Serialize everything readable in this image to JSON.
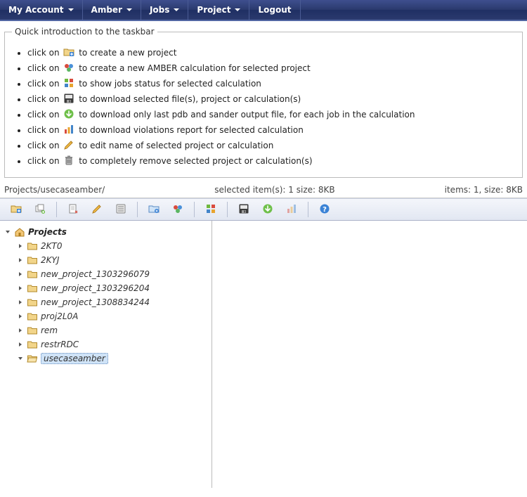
{
  "menubar": {
    "items": [
      {
        "label": "My Account",
        "dropdown": true
      },
      {
        "label": "Amber",
        "dropdown": true
      },
      {
        "label": "Jobs",
        "dropdown": true
      },
      {
        "label": "Project",
        "dropdown": true
      },
      {
        "label": "Logout",
        "dropdown": false
      }
    ]
  },
  "intro": {
    "legend": "Quick introduction to the taskbar",
    "items": [
      {
        "pre": "click on ",
        "icon": "new-project-icon",
        "post": " to create a new project"
      },
      {
        "pre": "click on ",
        "icon": "new-calc-icon",
        "post": " to create a new AMBER calculation for selected project"
      },
      {
        "pre": "click on ",
        "icon": "jobs-status-icon",
        "post": " to show jobs status for selected calculation"
      },
      {
        "pre": "click on ",
        "icon": "save-icon",
        "post": " to download selected file(s), project or calculation(s)"
      },
      {
        "pre": "click on ",
        "icon": "download-last-icon",
        "post": " to download only last pdb and sander output file, for each job in the calculation"
      },
      {
        "pre": "click on ",
        "icon": "violations-icon",
        "post": " to download violations report for selected calculation"
      },
      {
        "pre": "click on ",
        "icon": "edit-icon",
        "post": " to edit name of selected project or calculation"
      },
      {
        "pre": "click on ",
        "icon": "delete-icon",
        "post": " to completely remove selected project or calculation(s)"
      }
    ]
  },
  "statusline": {
    "path": "Projects/usecaseamber/",
    "selected": "selected item(s): 1 size: 8KB",
    "items": "items: 1, size: 8KB"
  },
  "toolbar": {
    "buttons": [
      {
        "name": "new-project-icon",
        "enabled": true
      },
      {
        "name": "copy-project-icon",
        "enabled": true
      },
      {
        "sep": true
      },
      {
        "name": "copy-calc-icon",
        "enabled": true
      },
      {
        "name": "edit-icon",
        "enabled": true
      },
      {
        "name": "properties-icon",
        "enabled": true
      },
      {
        "sep": true
      },
      {
        "name": "add-calc-icon",
        "enabled": true
      },
      {
        "name": "new-calc-icon",
        "enabled": true
      },
      {
        "sep": true
      },
      {
        "name": "jobs-status-icon",
        "enabled": true
      },
      {
        "sep": true
      },
      {
        "name": "save-icon",
        "enabled": true
      },
      {
        "name": "download-last-icon",
        "enabled": true
      },
      {
        "name": "violations-icon",
        "enabled": false
      },
      {
        "sep": true
      },
      {
        "name": "help-icon",
        "enabled": true
      }
    ]
  },
  "tree": {
    "root": {
      "label": "Projects",
      "expanded": true,
      "children": [
        {
          "label": "2KT0",
          "expanded": false,
          "selected": false
        },
        {
          "label": "2KYJ",
          "expanded": false,
          "selected": false
        },
        {
          "label": "new_project_1303296079",
          "expanded": false,
          "selected": false
        },
        {
          "label": "new_project_1303296204",
          "expanded": false,
          "selected": false
        },
        {
          "label": "new_project_1308834244",
          "expanded": false,
          "selected": false
        },
        {
          "label": "proj2L0A",
          "expanded": false,
          "selected": false
        },
        {
          "label": "rem",
          "expanded": false,
          "selected": false
        },
        {
          "label": "restrRDC",
          "expanded": false,
          "selected": false
        },
        {
          "label": "usecaseamber",
          "expanded": true,
          "selected": true
        }
      ]
    }
  }
}
